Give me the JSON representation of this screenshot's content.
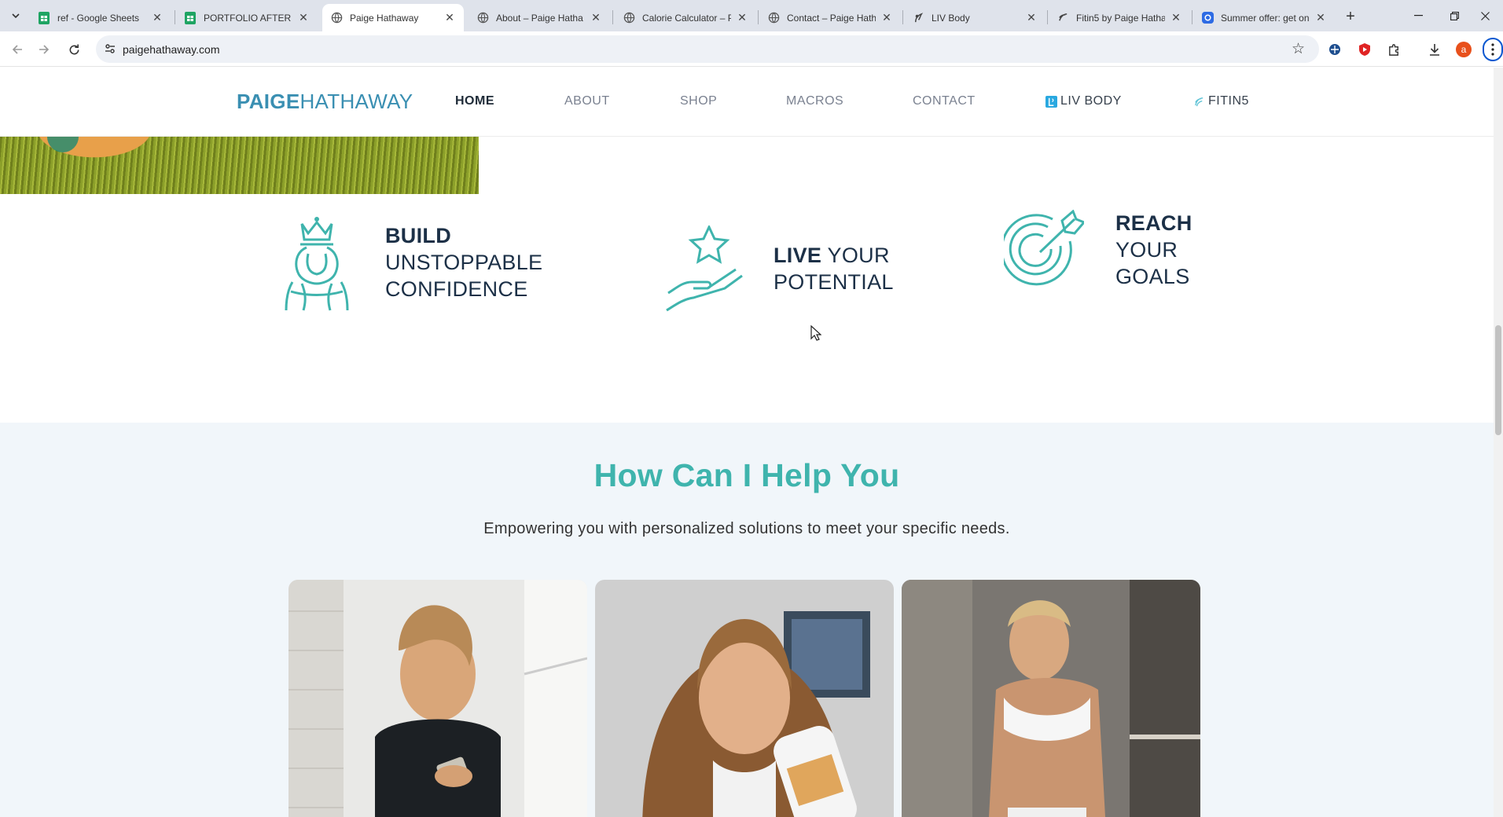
{
  "browser": {
    "tabs": [
      {
        "title": "ref - Google Sheets",
        "icon": "sheets-icon",
        "active": false
      },
      {
        "title": "PORTFOLIO AFTER SE",
        "icon": "sheets-icon",
        "active": false
      },
      {
        "title": "Paige Hathaway",
        "icon": "globe-icon",
        "active": true
      },
      {
        "title": "About – Paige Hatha",
        "icon": "globe-icon",
        "active": false
      },
      {
        "title": "Calorie Calculator – P",
        "icon": "globe-icon",
        "active": false
      },
      {
        "title": "Contact – Paige Hath",
        "icon": "globe-icon",
        "active": false
      },
      {
        "title": "LIV Body",
        "icon": "livbody-icon",
        "active": false
      },
      {
        "title": "Fitin5 by Paige Hatha",
        "icon": "fitin5-icon",
        "active": false
      },
      {
        "title": "Summer offer: get on",
        "icon": "offer-icon",
        "active": false
      }
    ],
    "url": "paigehathaway.com",
    "profile_initial": "a",
    "accent": "#0b57d0"
  },
  "site": {
    "logo": {
      "bold": "PAIGE",
      "light": "HATHAWAY"
    },
    "nav": [
      {
        "label": "HOME",
        "active": true
      },
      {
        "label": "ABOUT",
        "active": false
      },
      {
        "label": "SHOP",
        "active": false
      },
      {
        "label": "MACROS",
        "active": false
      },
      {
        "label": "CONTACT",
        "active": false
      },
      {
        "label": "LIV BODY",
        "active": false,
        "icon": "livbody-icon"
      },
      {
        "label": "FITIN5",
        "active": false,
        "icon": "fitin5-icon"
      }
    ],
    "values": [
      {
        "strong": "BUILD",
        "rest": [
          "UNSTOPPABLE",
          "CONFIDENCE"
        ],
        "icon": "queen-crown-icon"
      },
      {
        "strong": "LIVE",
        "rest_inline": "YOUR",
        "rest": [
          "POTENTIAL"
        ],
        "icon": "hand-star-icon"
      },
      {
        "strong": "REACH",
        "rest": [
          "YOUR",
          "GOALS"
        ],
        "icon": "target-arrow-icon"
      }
    ],
    "help": {
      "title": "How Can I Help You",
      "subtitle": "Empowering you with personalized solutions to meet your specific needs."
    },
    "colors": {
      "teal": "#3fb4ad",
      "navy": "#1c3047",
      "logo_blue": "#3a8fb2",
      "help_bg": "#f1f6fa"
    }
  }
}
